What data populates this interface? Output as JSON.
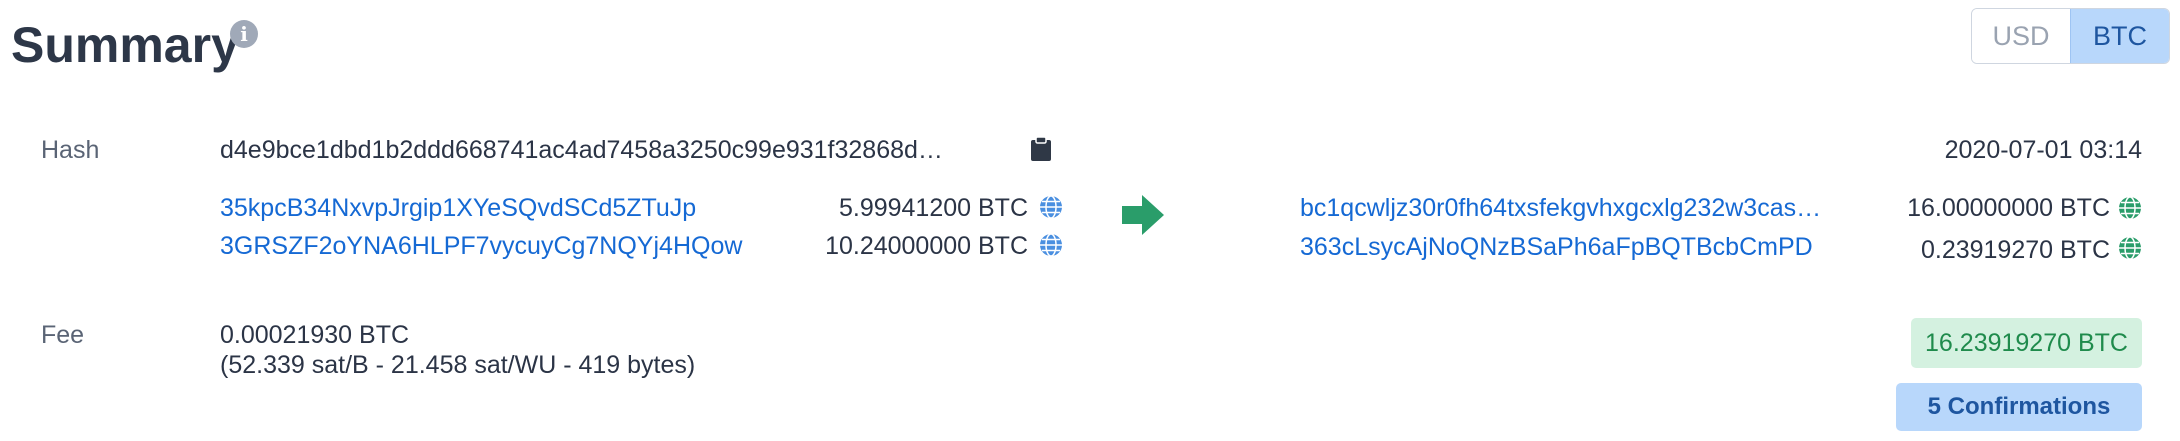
{
  "header": {
    "title": "Summary",
    "info_icon": "info-icon"
  },
  "currency_toggle": {
    "options": [
      "USD",
      "BTC"
    ],
    "selected": "BTC"
  },
  "hash": {
    "label": "Hash",
    "value": "d4e9bce1dbd1b2ddd668741ac4ad7458a3250c99e931f32868d…",
    "copy_icon": "clipboard-icon"
  },
  "timestamp": "2020-07-01 03:14",
  "inputs": [
    {
      "address": "35kpcB34NxvpJrgip1XYeSQvdSCd5ZTuJp",
      "amount": "5.99941200 BTC",
      "icon": "globe-icon"
    },
    {
      "address": "3GRSZF2oYNA6HLPF7vycuyCg7NQYj4HQow",
      "amount": "10.24000000 BTC",
      "icon": "globe-icon"
    }
  ],
  "flow_icon": "arrow-right-icon",
  "outputs": [
    {
      "address": "bc1qcwljz30r0fh64txsfekgvhxgcxlg232w3cas…",
      "amount": "16.00000000 BTC",
      "icon": "globe-icon"
    },
    {
      "address": "363cLsycAjNoQNzBSaPh6aFpBQTBcbCmPD",
      "amount": "0.23919270 BTC",
      "icon": "globe-icon"
    }
  ],
  "fee": {
    "label": "Fee",
    "amount": "0.00021930 BTC",
    "detail": "(52.339 sat/B - 21.458 sat/WU - 419 bytes)"
  },
  "total": "16.23919270 BTC",
  "confirmations": "5 Confirmations",
  "colors": {
    "link": "#1569d4",
    "accent_green": "#2a9d6a",
    "badge_blue": "#b8d7fb",
    "badge_green": "#d4f1e0"
  }
}
